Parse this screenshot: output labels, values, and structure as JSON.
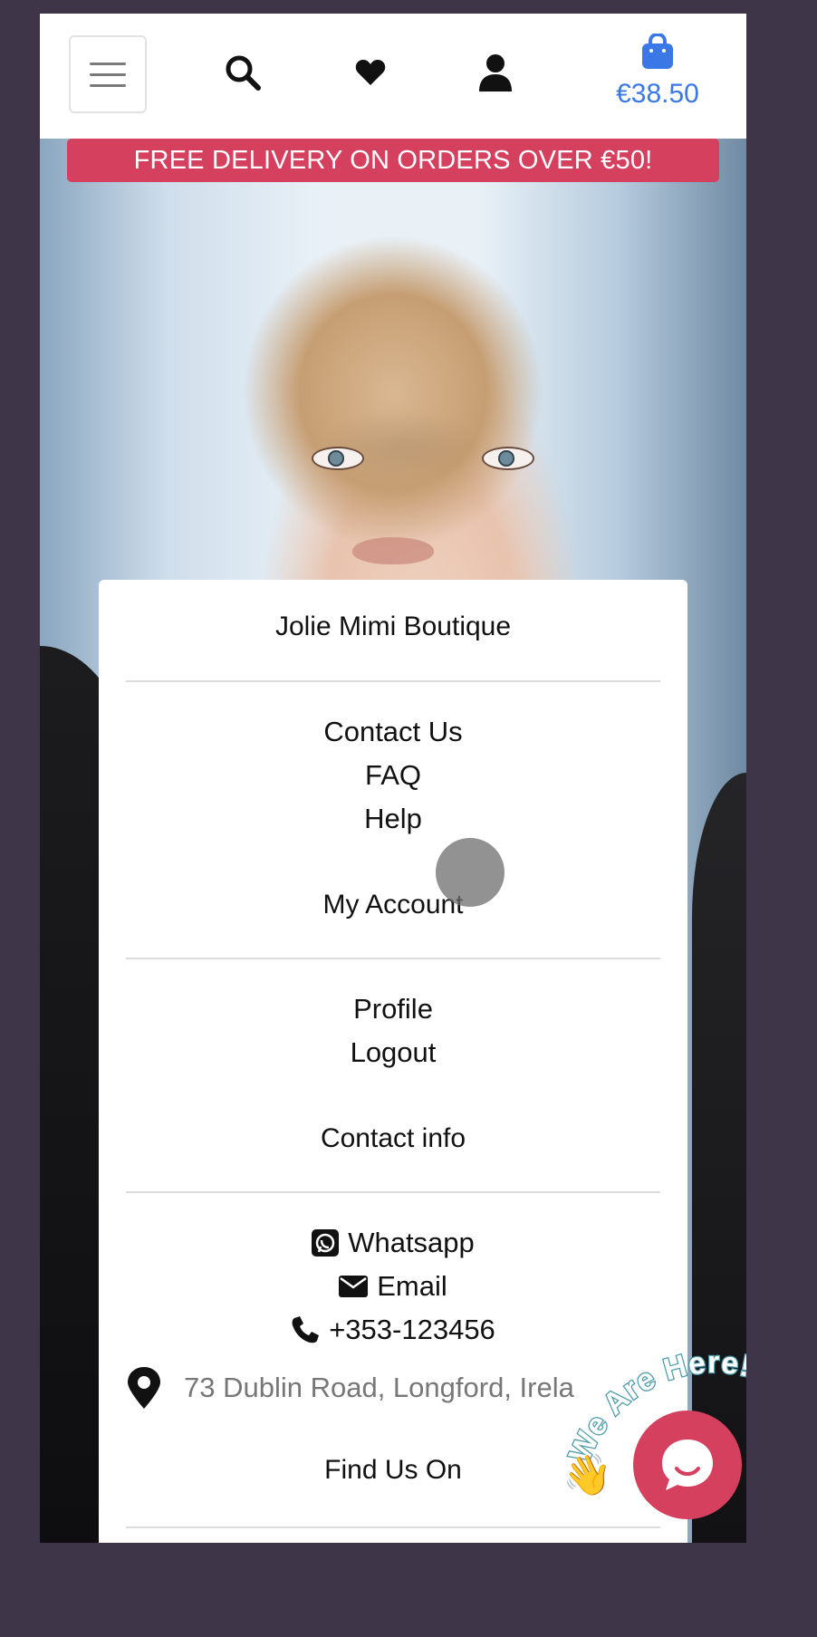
{
  "header": {
    "cart_total": "€38.50",
    "icons": [
      "menu-icon",
      "search-icon",
      "heart-icon",
      "user-icon",
      "shopping-bag-icon"
    ],
    "accent_color": "#3b78e7"
  },
  "banner": {
    "text": "FREE DELIVERY ON ORDERS OVER €50!",
    "color": "#d6405f"
  },
  "footer": {
    "brand_heading": "Jolie Mimi Boutique",
    "brand_links": [
      "Contact Us",
      "FAQ",
      "Help"
    ],
    "account_heading": "My Account",
    "account_links": [
      "Profile",
      "Logout"
    ],
    "contact_heading": "Contact info",
    "contact_links": [
      {
        "icon": "whatsapp-icon",
        "label": "Whatsapp"
      },
      {
        "icon": "envelope-icon",
        "label": "Email"
      },
      {
        "icon": "phone-icon",
        "label": "+353-123456"
      }
    ],
    "address": "73 Dublin Road, Longford, Irela",
    "find_heading": "Find Us On"
  },
  "chat_widget": {
    "tagline": "We Are Here!",
    "icon": "chat-icon",
    "color": "#d6405f"
  }
}
